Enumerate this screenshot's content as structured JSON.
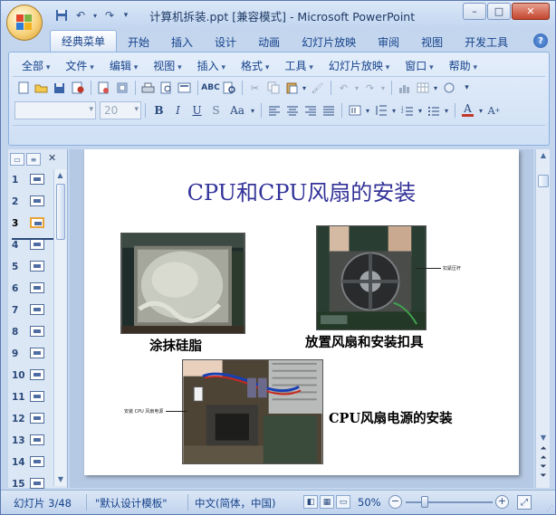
{
  "window": {
    "title": "计算机拆装.ppt [兼容模式] - Microsoft PowerPoint",
    "controls": [
      "–",
      "□",
      "✕"
    ]
  },
  "quick_access": {
    "icons": [
      "save-icon",
      "undo-icon",
      "redo-icon",
      "customize-dropdown-icon"
    ]
  },
  "ribbon": {
    "tabs": [
      "经典菜单",
      "开始",
      "插入",
      "设计",
      "动画",
      "幻灯片放映",
      "审阅",
      "视图",
      "开发工具"
    ],
    "active_tab": "经典菜单",
    "menus": [
      "全部",
      "文件",
      "编辑",
      "视图",
      "插入",
      "格式",
      "工具",
      "幻灯片放映",
      "窗口",
      "帮助"
    ],
    "font_name": "",
    "font_size": "20",
    "format_buttons": [
      "B",
      "I",
      "U",
      "S",
      "Aa"
    ]
  },
  "slides_panel": {
    "current": 3,
    "numbers": [
      "1",
      "2",
      "3",
      "4",
      "5",
      "6",
      "7",
      "8",
      "9",
      "10",
      "11",
      "12",
      "13",
      "14",
      "15"
    ]
  },
  "slide": {
    "title": "CPU和CPU风扇的安装",
    "captions": {
      "grease": "涂抹硅脂",
      "fan": "放置风扇和安装扣具",
      "power": "CPU风扇电源的安装"
    },
    "callouts": {
      "lever": "扣紧压杆",
      "power_label": "安装 CPU 风扇电源"
    }
  },
  "status": {
    "slide_counter": "幻灯片 3/48",
    "theme": "\"默认设计模板\"",
    "language": "中文(简体，中国)",
    "zoom": "50%"
  },
  "colors": {
    "title_blue": "#333399",
    "ribbon_text": "#15428b",
    "frame": "#c4d6ee"
  }
}
